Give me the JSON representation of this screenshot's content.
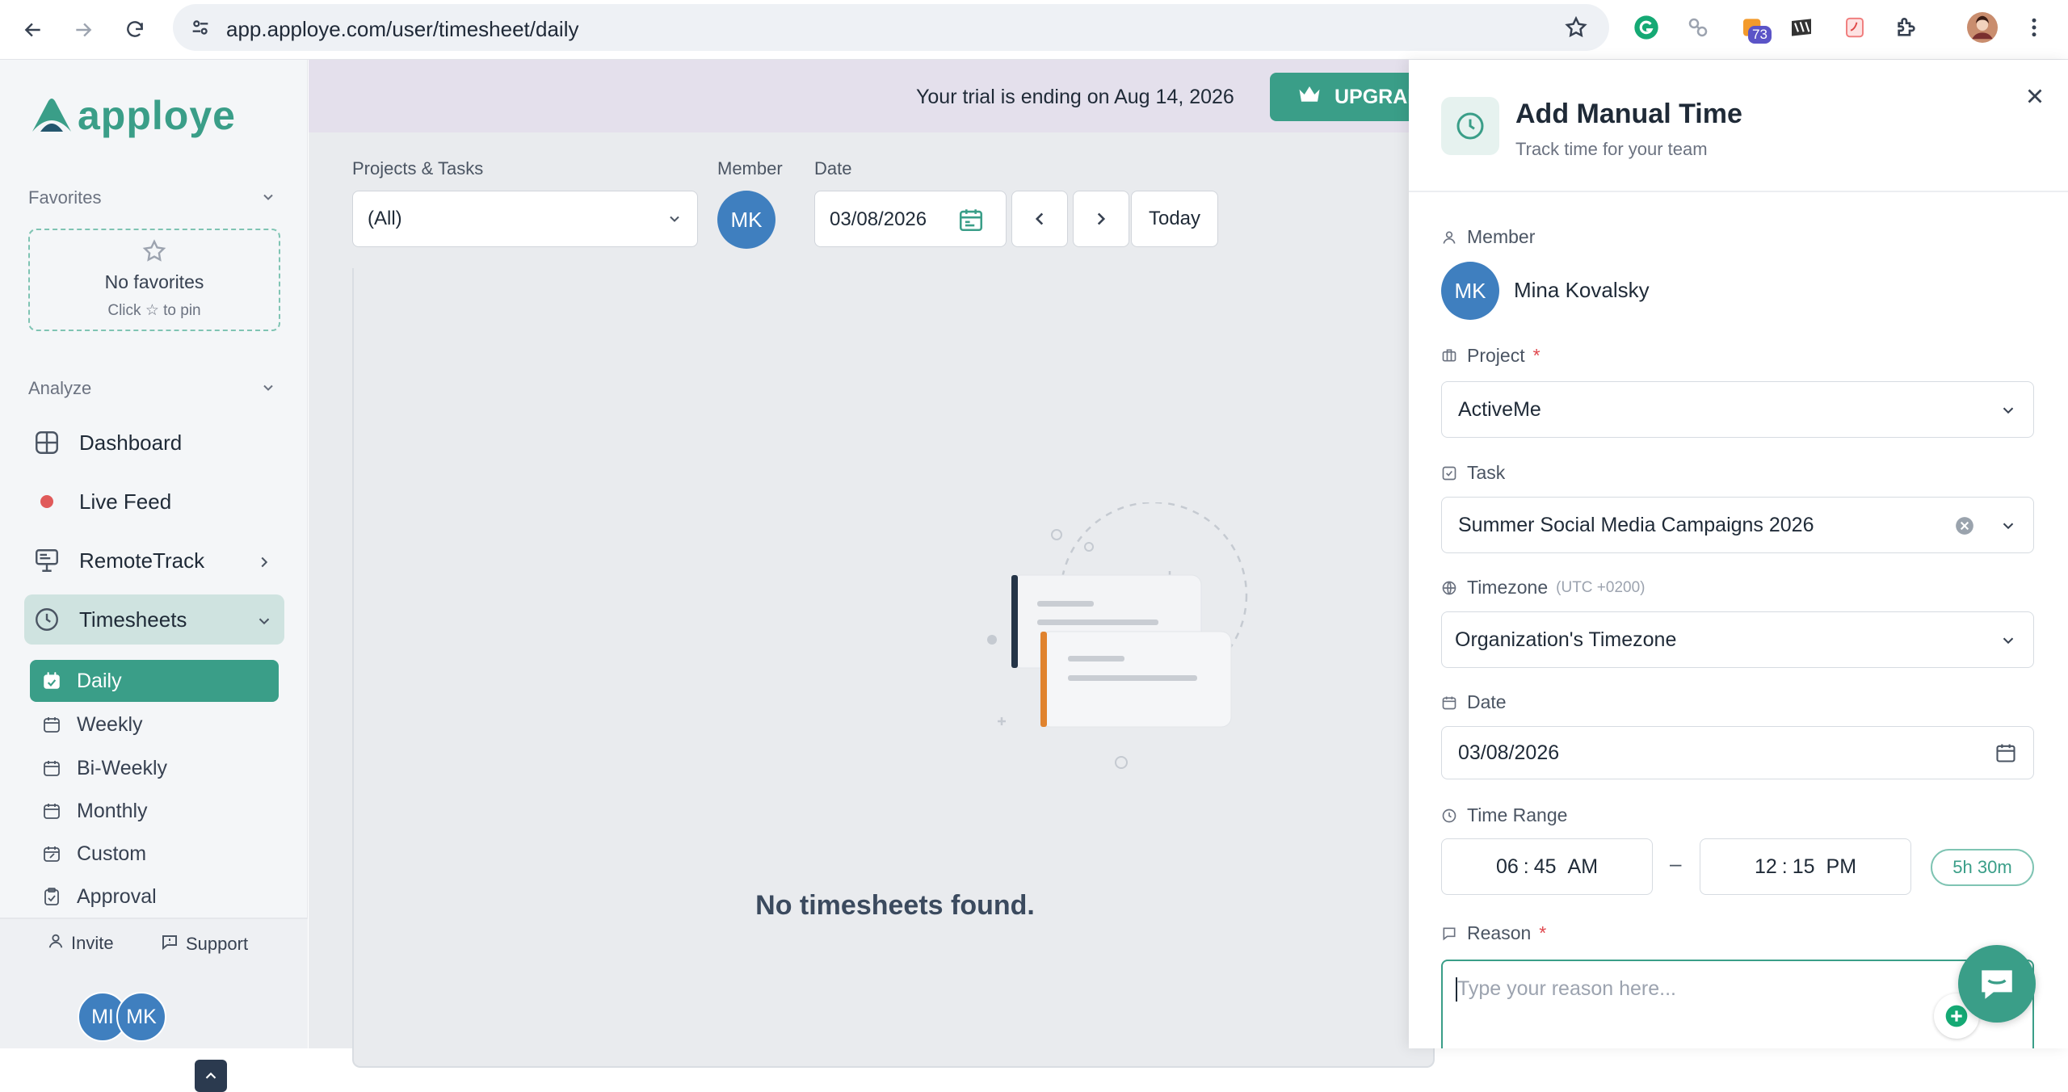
{
  "browser": {
    "url": "app.apploye.com/user/timesheet/daily",
    "extension_badge": "73"
  },
  "sidebar": {
    "logo": "apploye",
    "favorites_label": "Favorites",
    "no_favorites": "No favorites",
    "pin_hint_pre": "Click",
    "pin_hint_post": "to pin",
    "analyze_label": "Analyze",
    "items": [
      {
        "label": "Dashboard",
        "icon": "dashboard-icon"
      },
      {
        "label": "Live Feed",
        "icon": "live-dot-icon"
      },
      {
        "label": "RemoteTrack",
        "icon": "monitor-icon"
      },
      {
        "label": "Timesheets",
        "icon": "clock-icon"
      }
    ],
    "sub_items": [
      {
        "label": "Daily",
        "active": true
      },
      {
        "label": "Weekly"
      },
      {
        "label": "Bi-Weekly"
      },
      {
        "label": "Monthly"
      },
      {
        "label": "Custom"
      },
      {
        "label": "Approval"
      }
    ],
    "invite_label": "Invite",
    "support_label": "Support",
    "avatars": [
      "MI",
      "MK"
    ]
  },
  "main": {
    "trial_text": "Your trial is ending on Aug 14, 2026",
    "upgrade_label": "UPGRADE",
    "projects_label": "Projects & Tasks",
    "projects_value": "(All)",
    "member_label": "Member",
    "member_initials": "MK",
    "date_label": "Date",
    "date_value": "03/08/2026",
    "today_label": "Today",
    "empty_text": "No timesheets found."
  },
  "panel": {
    "title": "Add Manual Time",
    "subtitle": "Track time for your team",
    "member_label": "Member",
    "member_initials": "MK",
    "member_name": "Mina Kovalsky",
    "project_label": "Project",
    "required_mark": "*",
    "project_value": "ActiveMe",
    "task_label": "Task",
    "task_value": "Summer Social Media Campaigns 2026",
    "timezone_label": "Timezone",
    "timezone_offset": "(UTC +0200)",
    "timezone_value": "Organization's Timezone",
    "date_label": "Date",
    "date_value": "03/08/2026",
    "time_range_label": "Time Range",
    "start_hour": "06",
    "start_minute": "45",
    "start_period": "AM",
    "end_hour": "12",
    "end_minute": "15",
    "end_period": "PM",
    "range_separator": "–",
    "time_separator": ":",
    "duration": "5h 30m",
    "reason_label": "Reason",
    "reason_placeholder": "Type your reason here..."
  },
  "colors": {
    "brand": "#3a9e88",
    "avatar": "#3f7fbf",
    "required": "#e0484e",
    "live": "#e05a5a",
    "empty_text": "#3b4a5e"
  }
}
